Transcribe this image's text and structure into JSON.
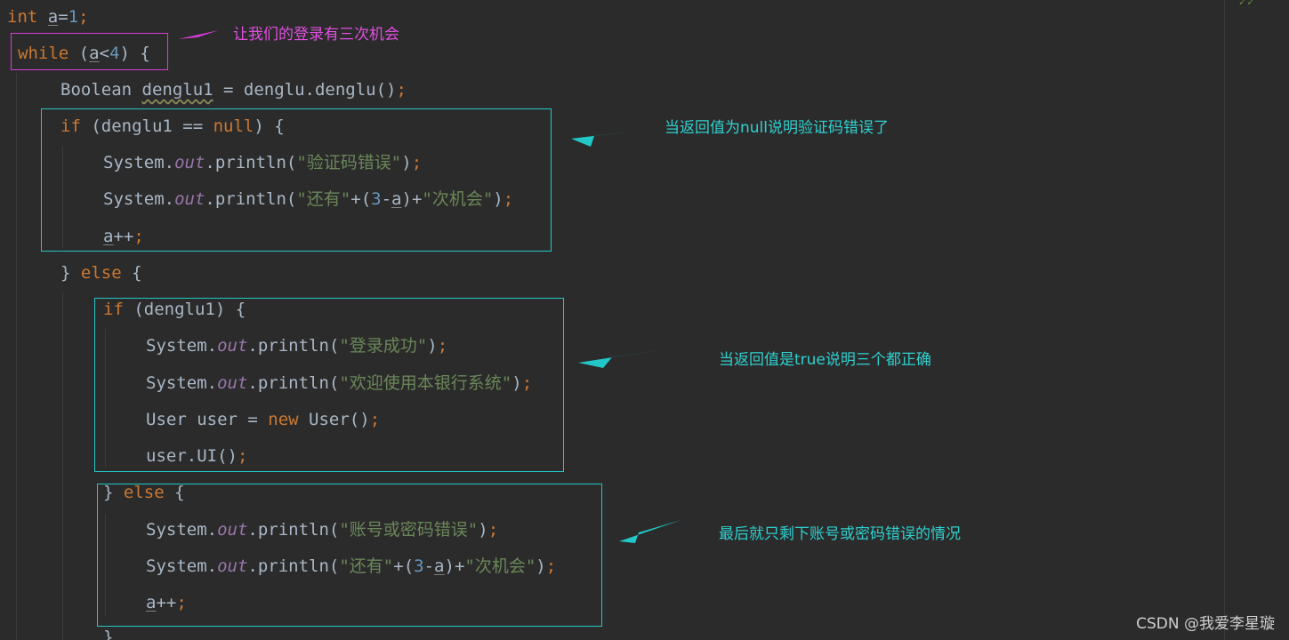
{
  "code": {
    "lines": [
      {
        "tokens": [
          {
            "t": "int ",
            "c": "kw"
          },
          {
            "t": "a",
            "c": "var-u"
          },
          {
            "t": "=",
            "c": ""
          },
          {
            "t": "1",
            "c": "num"
          },
          {
            "t": ";",
            "c": "punc"
          }
        ]
      },
      {
        "tokens": [
          {
            "t": "while",
            "c": "kw"
          },
          {
            "t": " (",
            "c": ""
          },
          {
            "t": "a",
            "c": "var-u"
          },
          {
            "t": "<",
            "c": ""
          },
          {
            "t": "4",
            "c": "num"
          },
          {
            "t": ") {",
            "c": ""
          }
        ]
      },
      {
        "tokens": [
          {
            "t": "Boolean ",
            "c": ""
          },
          {
            "t": "denglu1",
            "c": "var-wavy"
          },
          {
            "t": " = denglu.denglu()",
            "c": ""
          },
          {
            "t": ";",
            "c": "punc"
          }
        ]
      },
      {
        "tokens": [
          {
            "t": "if",
            "c": "kw"
          },
          {
            "t": " (denglu1 == ",
            "c": ""
          },
          {
            "t": "null",
            "c": "kw"
          },
          {
            "t": ") {",
            "c": ""
          }
        ]
      },
      {
        "tokens": [
          {
            "t": "System.",
            "c": ""
          },
          {
            "t": "out",
            "c": "field"
          },
          {
            "t": ".println(",
            "c": ""
          },
          {
            "t": "\"验证码错误\"",
            "c": "str"
          },
          {
            "t": ")",
            "c": ""
          },
          {
            "t": ";",
            "c": "punc"
          }
        ]
      },
      {
        "tokens": [
          {
            "t": "System.",
            "c": ""
          },
          {
            "t": "out",
            "c": "field"
          },
          {
            "t": ".println(",
            "c": ""
          },
          {
            "t": "\"还有\"",
            "c": "str"
          },
          {
            "t": "+(",
            "c": ""
          },
          {
            "t": "3",
            "c": "num"
          },
          {
            "t": "-",
            "c": ""
          },
          {
            "t": "a",
            "c": "var-u"
          },
          {
            "t": ")+",
            "c": ""
          },
          {
            "t": "\"次机会\"",
            "c": "str"
          },
          {
            "t": ")",
            "c": ""
          },
          {
            "t": ";",
            "c": "punc"
          }
        ]
      },
      {
        "tokens": [
          {
            "t": "a",
            "c": "var-u"
          },
          {
            "t": "++",
            "c": ""
          },
          {
            "t": ";",
            "c": "punc"
          }
        ]
      },
      {
        "tokens": [
          {
            "t": "} ",
            "c": ""
          },
          {
            "t": "else",
            "c": "kw"
          },
          {
            "t": " {",
            "c": ""
          }
        ]
      },
      {
        "tokens": [
          {
            "t": "if",
            "c": "kw"
          },
          {
            "t": " (denglu1) {",
            "c": ""
          }
        ]
      },
      {
        "tokens": [
          {
            "t": "System.",
            "c": ""
          },
          {
            "t": "out",
            "c": "field"
          },
          {
            "t": ".println(",
            "c": ""
          },
          {
            "t": "\"登录成功\"",
            "c": "str"
          },
          {
            "t": ")",
            "c": ""
          },
          {
            "t": ";",
            "c": "punc"
          }
        ]
      },
      {
        "tokens": [
          {
            "t": "System.",
            "c": ""
          },
          {
            "t": "out",
            "c": "field"
          },
          {
            "t": ".println(",
            "c": ""
          },
          {
            "t": "\"欢迎使用本银行系统\"",
            "c": "str"
          },
          {
            "t": ")",
            "c": ""
          },
          {
            "t": ";",
            "c": "punc"
          }
        ]
      },
      {
        "tokens": [
          {
            "t": "User user = ",
            "c": ""
          },
          {
            "t": "new",
            "c": "kw"
          },
          {
            "t": " User()",
            "c": ""
          },
          {
            "t": ";",
            "c": "punc"
          }
        ]
      },
      {
        "tokens": [
          {
            "t": "user.UI()",
            "c": ""
          },
          {
            "t": ";",
            "c": "punc"
          }
        ]
      },
      {
        "tokens": [
          {
            "t": "} ",
            "c": ""
          },
          {
            "t": "else",
            "c": "kw"
          },
          {
            "t": " {",
            "c": ""
          }
        ]
      },
      {
        "tokens": [
          {
            "t": "System.",
            "c": ""
          },
          {
            "t": "out",
            "c": "field"
          },
          {
            "t": ".println(",
            "c": ""
          },
          {
            "t": "\"账号或密码错误\"",
            "c": "str"
          },
          {
            "t": ")",
            "c": ""
          },
          {
            "t": ";",
            "c": "punc"
          }
        ]
      },
      {
        "tokens": [
          {
            "t": "System.",
            "c": ""
          },
          {
            "t": "out",
            "c": "field"
          },
          {
            "t": ".println(",
            "c": ""
          },
          {
            "t": "\"还有\"",
            "c": "str"
          },
          {
            "t": "+(",
            "c": ""
          },
          {
            "t": "3",
            "c": "num"
          },
          {
            "t": "-",
            "c": ""
          },
          {
            "t": "a",
            "c": "var-u"
          },
          {
            "t": ")+",
            "c": ""
          },
          {
            "t": "\"次机会\"",
            "c": "str"
          },
          {
            "t": ")",
            "c": ""
          },
          {
            "t": ";",
            "c": "punc"
          }
        ]
      },
      {
        "tokens": [
          {
            "t": "a",
            "c": "var-u"
          },
          {
            "t": "++",
            "c": ""
          },
          {
            "t": ";",
            "c": "punc"
          }
        ]
      },
      {
        "tokens": [
          {
            "t": "}",
            "c": ""
          }
        ]
      }
    ]
  },
  "annotations": {
    "loop_note": "让我们的登录有三次机会",
    "null_note": "当返回值为null说明验证码错误了",
    "true_note": "当返回值是true说明三个都正确",
    "false_note": "最后就只剩下账号或密码错误的情况"
  },
  "watermark": "CSDN @我爱李星璇",
  "colors": {
    "background": "#2b2b2b",
    "keyword": "#cc7832",
    "string": "#6a8759",
    "number": "#6897bb",
    "field": "#9876aa",
    "default_text": "#a9b7c6",
    "box_cyan": "#22c8c8",
    "box_magenta": "#d93cd9"
  },
  "icons": {
    "arrow": "arrow-left-icon"
  }
}
